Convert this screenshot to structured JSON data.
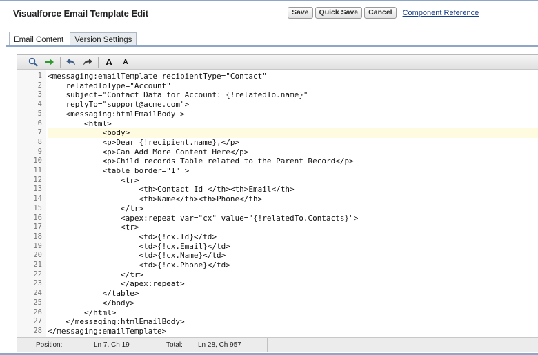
{
  "page": {
    "title": "Visualforce Email Template Edit"
  },
  "toolbar": {
    "save_label": "Save",
    "quick_save_label": "Quick Save",
    "cancel_label": "Cancel",
    "reference_link": "Component Reference"
  },
  "tabs": [
    {
      "label": "Email Content",
      "active": true
    },
    {
      "label": "Version Settings",
      "active": false
    }
  ],
  "editor_toolbar": {
    "icons": [
      "search-icon",
      "go-to-line-icon",
      "undo-icon",
      "redo-icon",
      "increase-font-icon",
      "decrease-font-icon"
    ],
    "font_large_glyph": "A",
    "font_small_glyph": "A"
  },
  "code": {
    "highlighted_line": 7,
    "lines": [
      "<messaging:emailTemplate recipientType=\"Contact\"",
      "    relatedToType=\"Account\"",
      "    subject=\"Contact Data for Account: {!relatedTo.name}\"",
      "    replyTo=\"support@acme.com\">",
      "    <messaging:htmlEmailBody >",
      "        <html>",
      "            <body>",
      "            <p>Dear {!recipient.name},</p>",
      "            <p>Can Add More Content Here</p>",
      "            <p>Child records Table related to the Parent Record</p>",
      "            <table border=\"1\" >",
      "                <tr>",
      "                    <th>Contact Id </th><th>Email</th>",
      "                    <th>Name</th><th>Phone</th>",
      "                </tr>",
      "                <apex:repeat var=\"cx\" value=\"{!relatedTo.Contacts}\">",
      "                <tr>",
      "                    <td>{!cx.Id}</td>",
      "                    <td>{!cx.Email}</td>",
      "                    <td>{!cx.Name}</td>",
      "                    <td>{!cx.Phone}</td>",
      "                </tr>",
      "                </apex:repeat>",
      "            </table>",
      "            </body>",
      "        </html>",
      "    </messaging:htmlEmailBody>",
      "</messaging:emailTemplate>"
    ]
  },
  "status": {
    "position_label": "Position:",
    "position_value": "Ln 7, Ch 19",
    "total_label": "Total:",
    "total_value": "Ln 28, Ch 957"
  },
  "colors": {
    "accent_line": "#8ea7c9",
    "highlight_line": "#fffbe0",
    "link": "#1a3f8a"
  }
}
